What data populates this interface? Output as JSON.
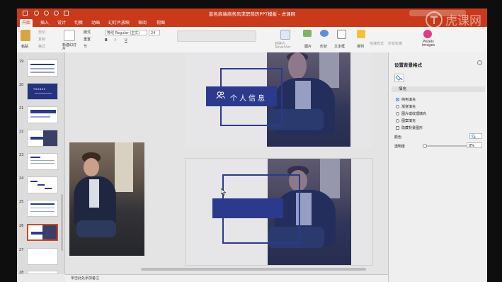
{
  "window": {
    "title": "蓝色商端商务风求职简历PPT模板 - 虎课网"
  },
  "tabs": [
    "开始",
    "插入",
    "设计",
    "切换",
    "动画",
    "幻灯片放映",
    "审阅",
    "视图"
  ],
  "ribbon": {
    "paste": "粘贴",
    "cut": "剪切",
    "copy": "复制",
    "format": "格式",
    "new_slide": "新建幻灯片",
    "layout": "版式",
    "reset": "重置",
    "section": "节",
    "font_name": "等线 Regular (正文)",
    "font_size": "24",
    "smartart": "转换为SmartArt",
    "picture": "图片",
    "shape": "形状",
    "textbox": "文本框",
    "arrange": "排列",
    "quick_styles": "快速样式",
    "shape_outline": "形状轮廓",
    "pexels": "Pexels Images"
  },
  "slides": {
    "numbers": [
      "19",
      "20",
      "21",
      "22",
      "23",
      "24",
      "25",
      "26",
      "27",
      "28"
    ],
    "thumb_title": "THANKS"
  },
  "slide_content": {
    "bar_text": "个人信息"
  },
  "notes_placeholder": "单击此处添加备注",
  "format_pane": {
    "title": "设置背景格式",
    "section": "填充",
    "options": [
      "纯色填充",
      "渐变填充",
      "图片或纹理填充",
      "图案填充"
    ],
    "hide_bg": "隐藏背景图形",
    "color_label": "颜色",
    "transparency_label": "透明度",
    "transparency_value": "0%"
  },
  "watermark": "虎课网",
  "colors": {
    "accent": "#c9391a",
    "slide_blue": "#2b3a8c"
  }
}
